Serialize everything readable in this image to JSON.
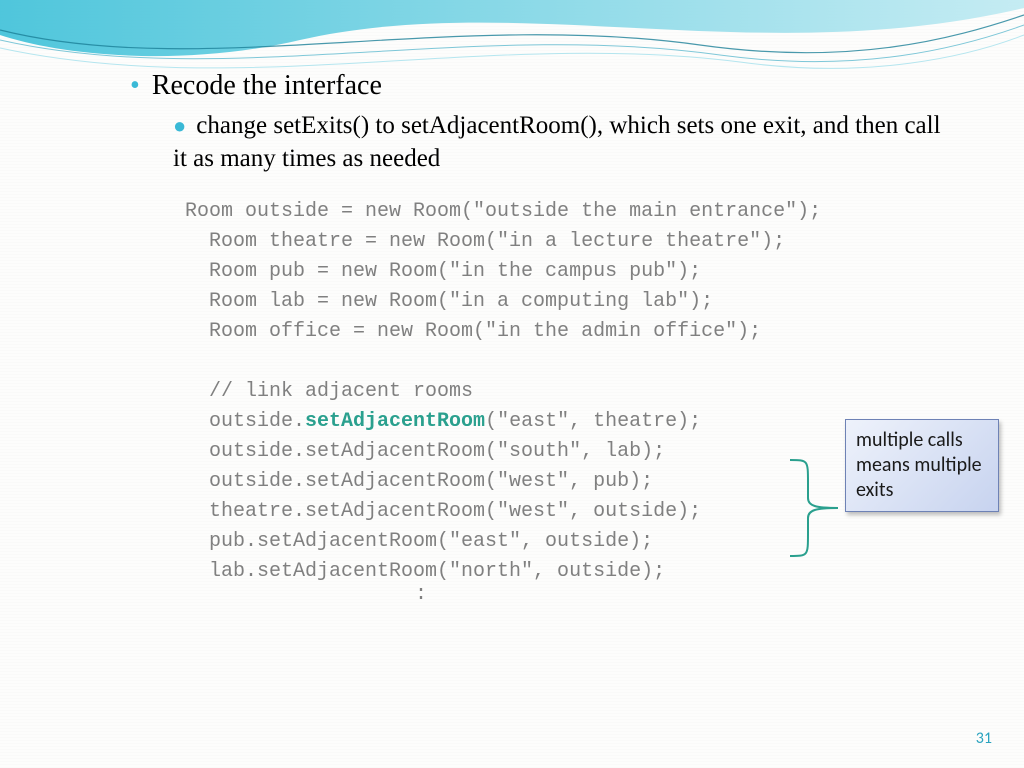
{
  "bullets": {
    "lvl1": "Recode the interface",
    "lvl2": "change setExits() to setAdjacentRoom(), which sets one exit, and then call it as many times as needed"
  },
  "code": {
    "l1": "Room outside = new Room(\"outside the main entrance\");",
    "l2": "  Room theatre = new Room(\"in a lecture theatre\");",
    "l3": "  Room pub = new Room(\"in the campus pub\");",
    "l4": "  Room lab = new Room(\"in a computing lab\");",
    "l5": "  Room office = new Room(\"in the admin office\");",
    "l6": "",
    "l7": "  // link adjacent rooms",
    "l8a": "  outside.",
    "l8b": "setAdjacentRoom",
    "l8c": "(\"east\", theatre);",
    "l9": "  outside.setAdjacentRoom(\"south\", lab);",
    "l10": "  outside.setAdjacentRoom(\"west\", pub);",
    "l11": "  theatre.setAdjacentRoom(\"west\", outside);",
    "l12": "  pub.setAdjacentRoom(\"east\", outside);",
    "l13": "  lab.setAdjacentRoom(\"north\", outside);",
    "cont": ":"
  },
  "callout": "multiple calls means multiple exits",
  "page_number": "31"
}
